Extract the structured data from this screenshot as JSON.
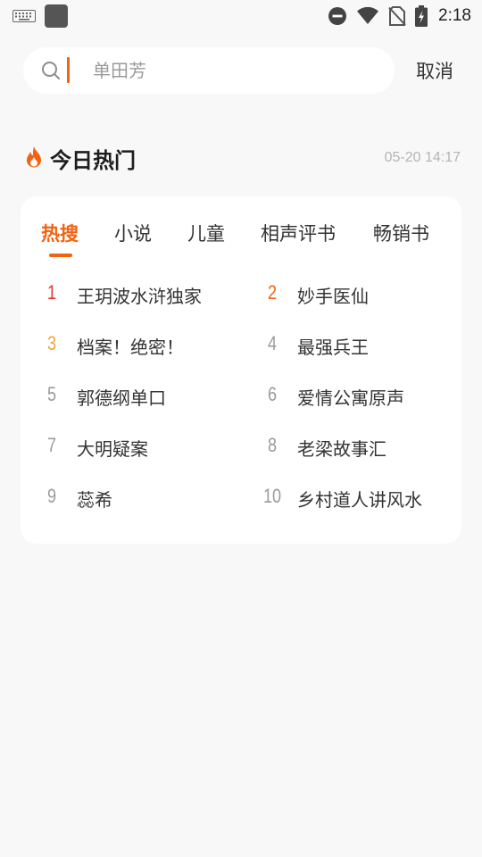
{
  "status_bar": {
    "time": "2:18",
    "icons": [
      "keyboard-icon",
      "app-icon",
      "minus-circle-icon",
      "wifi-icon",
      "no-sim-icon",
      "battery-charging-icon"
    ]
  },
  "search": {
    "placeholder": "单田芳",
    "value": "",
    "cancel_label": "取消"
  },
  "hot_section": {
    "title": "今日热门",
    "updated_at": "05-20 14:17"
  },
  "tabs": [
    {
      "label": "热搜",
      "active": true
    },
    {
      "label": "小说",
      "active": false
    },
    {
      "label": "儿童",
      "active": false
    },
    {
      "label": "相声评书",
      "active": false
    },
    {
      "label": "畅销书",
      "active": false
    }
  ],
  "rankings": [
    {
      "rank": "1",
      "title": "王玥波水浒独家"
    },
    {
      "rank": "2",
      "title": "妙手医仙"
    },
    {
      "rank": "3",
      "title": "档案！绝密！"
    },
    {
      "rank": "4",
      "title": "最强兵王"
    },
    {
      "rank": "5",
      "title": "郭德纲单口"
    },
    {
      "rank": "6",
      "title": "爱情公寓原声"
    },
    {
      "rank": "7",
      "title": "大明疑案"
    },
    {
      "rank": "8",
      "title": "老梁故事汇"
    },
    {
      "rank": "9",
      "title": "蕊希"
    },
    {
      "rank": "10",
      "title": "乡村道人讲风水"
    }
  ],
  "colors": {
    "accent": "#f46210",
    "rank1": "#e8332a",
    "rank3": "#f5a03a",
    "rank_default": "#9a9a9a"
  }
}
